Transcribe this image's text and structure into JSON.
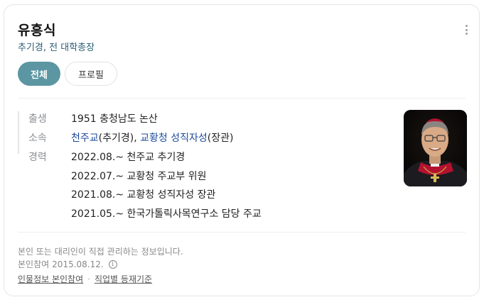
{
  "header": {
    "name": "유흥식",
    "subtitle": "추기경, 전 대학총장"
  },
  "tabs": [
    {
      "label": "전체",
      "active": true
    },
    {
      "label": "프로필",
      "active": false
    }
  ],
  "profile": {
    "birth": {
      "label": "출생",
      "value": "1951 충청남도 논산"
    },
    "affiliation": {
      "label": "소속",
      "link1": "천주교",
      "text1": "(추기경), ",
      "link2": "교황청 성직자성",
      "text2": "(장관)"
    },
    "career": {
      "label": "경력",
      "items": [
        "2022.08.~ 천주교 추기경",
        "2022.07.~ 교황청 주교부 위원",
        "2021.08.~ 교황청 성직자성 장관",
        "2021.05.~ 한국가톨릭사목연구소 담당 주교"
      ]
    }
  },
  "footer": {
    "notice": "본인 또는 대리인이 직접 관리하는 정보입니다.",
    "participation_label": "본인참여",
    "participation_date": "2015.08.12.",
    "links": [
      "인물정보 본인참여",
      "직업별 등재기준"
    ]
  },
  "colors": {
    "accent": "#5b96a2",
    "link": "#1d4a9c",
    "subtitle": "#2a5d74"
  }
}
